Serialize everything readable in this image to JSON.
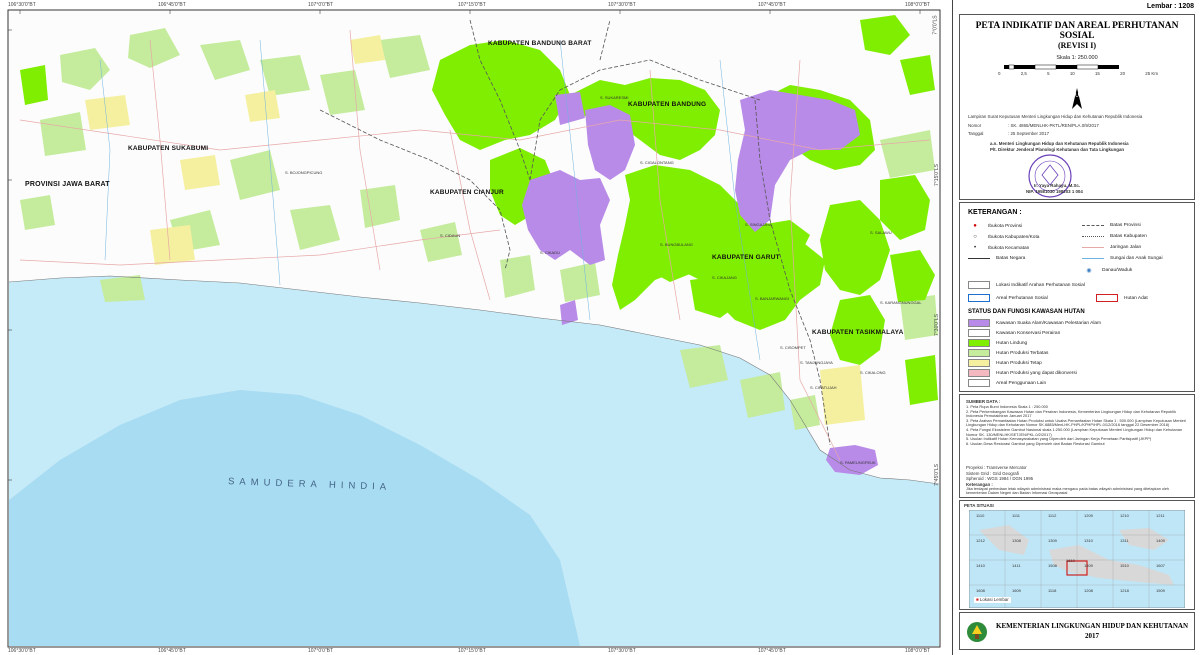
{
  "sheet": {
    "label": "Lembar :",
    "number": "1208"
  },
  "map": {
    "top_coords": [
      "106°30'0\"BT",
      "106°45'0\"BT",
      "107°0'0\"BT",
      "107°15'0\"BT",
      "107°30'0\"BT",
      "107°45'0\"BT",
      "108°0'0\"BT"
    ],
    "left_coords": [
      "7°0'0\"LS",
      "7°15'0\"LS",
      "7°30'0\"LS",
      "7°45'0\"LS"
    ],
    "regions": {
      "bandung_barat": "KABUPATEN BANDUNG BARAT",
      "bandung": "KABUPATEN BANDUNG",
      "sukabumi": "KABUPATEN SUKABUMI",
      "cianjur": "KABUPATEN CIANJUR",
      "garut": "KABUPATEN GARUT",
      "tasikmalaya": "KABUPATEN TASIKMALAYA",
      "jawa_barat": "PROVINSI JAWA BARAT"
    },
    "sea": "SAMUDERA HINDIA",
    "towns": [
      "S. PAMEUNGPEUK",
      "S. CIDAUN",
      "S. BOJONGPICUNG",
      "S. CIKADU",
      "S. BUNGBULANG",
      "S. SINGAJAYA",
      "S. CIKAJANG",
      "S. BANJARWANGI",
      "S. CISOMPET",
      "S. TANJUNGJAYA",
      "S. SUKARESMI",
      "S. CIGALONTANG",
      "S. SALAWU",
      "S. CIKALONG",
      "S. CIPATUJAH",
      "S. KARANGNUNGGAL"
    ]
  },
  "title": {
    "line1": "PETA INDIKATIF DAN AREAL PERHUTANAN SOSIAL",
    "line2": "(REVISI I)",
    "scale": "Skala 1: 250.000",
    "scale_ticks": [
      "0",
      "2,5",
      "5",
      "10",
      "15",
      "20",
      "25 Km"
    ],
    "decree": "Lampiran Surat Keputusan Menteri Lingkungan Hidup dan Kehutanan Republik Indonesia",
    "nomor_label": "Nomor",
    "nomor_value": ": SK. 4865/MENLHK-PKTL/REN/PLA.0/9/2017",
    "tanggal_label": "Tanggal",
    "tanggal_value": ": 25 September 2017",
    "sign1": "a.n. Menteri Lingkungan Hidup dan Kehutanan Republik Indonesia",
    "sign2": "Plt. Direktur Jenderal Planologi Kehutanan dan Tata Lingkungan",
    "signer": "Ir. Yaya Rahayu, M.Sc.",
    "nip": "NIP. 19581030 198203 1 004"
  },
  "legend": {
    "heading": "KETERANGAN :",
    "symbols_left": [
      "Ibukota Provinsi",
      "Ibukota Kabupaten/Kota",
      "Ibukota Kecamatan",
      "Batas Negara"
    ],
    "symbols_right": [
      "Batas Provinsi",
      "Batas Kabupaten",
      "Jaringan Jalan",
      "Sungai dan Anak Sungai",
      "Danau/Waduk"
    ],
    "lokasi": "Lokasi Indikatif Arahan Perhutanan Sosial",
    "areal": "Areal Perhutanan Sosial",
    "hutan_adat": "Hutan Adat",
    "status_heading": "STATUS DAN FUNGSI KAWASAN HUTAN",
    "status_items": [
      {
        "label": "Kawasan Suaka Alam/Kawasan Pelestarian Alam",
        "color": "#b98be8"
      },
      {
        "label": "Kawasan Konservasi Perairan",
        "color": "#ffffff"
      },
      {
        "label": "Hutan Lindung",
        "color": "#80ee00"
      },
      {
        "label": "Hutan Produksi Terbatas",
        "color": "#c4ec9c"
      },
      {
        "label": "Hutan Produksi Tetap",
        "color": "#f5f0a0"
      },
      {
        "label": "Hutan Produksi yang dapat dikonversi",
        "color": "#f4b8c0"
      },
      {
        "label": "Areal Penggunaan Lain",
        "color": "#ffffff"
      }
    ]
  },
  "sources": {
    "heading": "SUMBER DATA :",
    "items": [
      "1. Peta Rupa Bumi Indonesia Skala 1 : 250.000",
      "2. Peta Perkembangan Kawasan Hutan dan Perairan Indonesia, Kementerian Lingkungan Hidup dan Kehutanan Republik Indonesia Pemutakhiran Januari 2017",
      "3. Peta Arahan Pemanfaatan Hutan Produksi untuk Usaha Pemanfaatan Hutan Skala 1 : 500.000 (Lampiran Keputusan Menteri Lingkungan Hidup dan Kehutanan Nomor SK.6885/MenLHK-PHPL/KPHP/HPL.0/12/2016 tanggal 22 Desember 2016)",
      "4. Peta Fungsi Ekosistem Gambut Nasional skala 1:250.000 (Lampiran Keputusan Menteri Lingkungan Hidup dan Kehutanan Nomor SK. 130/MENLHK/SETJEN/PKL.0/2/2017)",
      "5. Usulan Indikatif Hutan Kemasyarakatan yang Diperoleh dari Jaringan Kerja Pemetaan Partisipatif (JKPP)",
      "6. Usulan Desa Restorasi Gambut yang Diperoleh dari Badan Restorasi Gambut"
    ],
    "proj": [
      "Proyeksi : Transverse Mercator",
      "Sistem Grid : Grid Geografi",
      "Spheroid : WGS 1984 / DGN 1995"
    ],
    "note_heading": "Keterangan :",
    "note": "Jika terdapat perbedaan letak wilayah administrasi maka mengacu pada batas wilayah administrasi yang ditetapkan oleh kementerian Dalam Negeri dan Badan Informasi Geospasial"
  },
  "inset": {
    "heading": "PETA SITUASI",
    "sheets": [
      "1110",
      "1111",
      "1112",
      "1209",
      "1210",
      "1211",
      "1212",
      "1308",
      "1309",
      "1310",
      "1311",
      "1409",
      "1410",
      "1411",
      "1508",
      "1509",
      "1510",
      "1607",
      "1608",
      "1609",
      "1118",
      "1208",
      "1218",
      "1509",
      "1610"
    ],
    "caption": "Lokasi Lembar"
  },
  "footer": {
    "org": "KEMENTERIAN LINGKUNGAN HIDUP DAN KEHUTANAN",
    "year": "2017"
  }
}
